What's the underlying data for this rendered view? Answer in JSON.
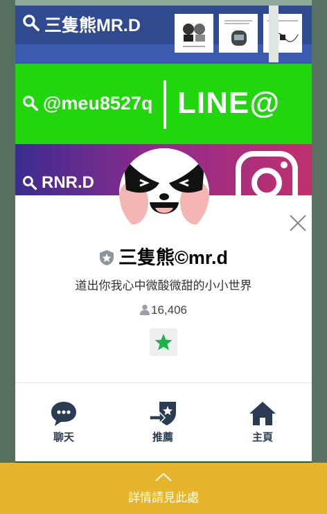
{
  "banners": {
    "blog_search": "三隻熊MR.D",
    "line_search": "@meu8527q",
    "line_logo": "LINE@",
    "instagram_search": "RNR.D"
  },
  "profile": {
    "name": "三隻熊©mr.d",
    "status_message": "道出你我心中微酸微甜的小小世界",
    "friend_count": "16,406"
  },
  "actions": [
    {
      "label": "聊天"
    },
    {
      "label": "推薦"
    },
    {
      "label": "主頁"
    }
  ],
  "bottom_bar": {
    "label": "詳情請見此處"
  },
  "colors": {
    "line_green": "#22d60e",
    "bottom_bar": "#e6b52c",
    "icon_navy": "#2a3b52",
    "favorite_star": "#19b34a"
  },
  "icons": [
    "search-icon",
    "shield-icon",
    "person-icon",
    "star-icon",
    "chat-bubble-icon",
    "share-icon",
    "home-icon",
    "close-icon",
    "chevron-up-icon",
    "instagram-icon"
  ]
}
